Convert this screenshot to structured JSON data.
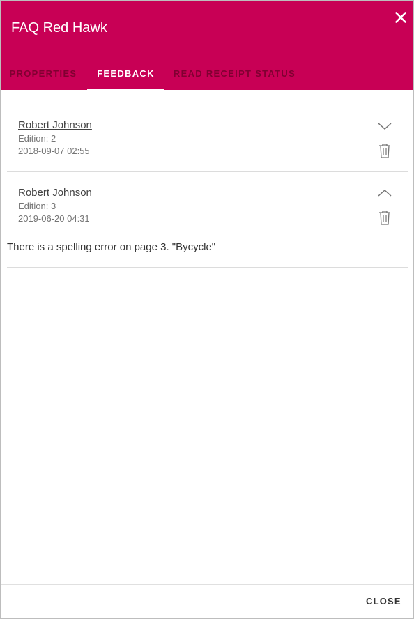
{
  "dialog": {
    "title": "FAQ Red Hawk",
    "accent_color": "#c80055"
  },
  "tabs": [
    {
      "label": "PROPERTIES",
      "active": false
    },
    {
      "label": "FEEDBACK",
      "active": true
    },
    {
      "label": "READ RECEIPT STATUS",
      "active": false
    }
  ],
  "feedback": [
    {
      "author": "Robert Johnson",
      "edition": "Edition: 2",
      "date": "2018-09-07 02:55",
      "expanded": false,
      "comment": ""
    },
    {
      "author": "Robert Johnson",
      "edition": "Edition: 3",
      "date": "2019-06-20 04:31",
      "expanded": true,
      "comment": "There is a spelling error on page 3. \"Bycycle\""
    }
  ],
  "footer": {
    "close_label": "CLOSE"
  }
}
